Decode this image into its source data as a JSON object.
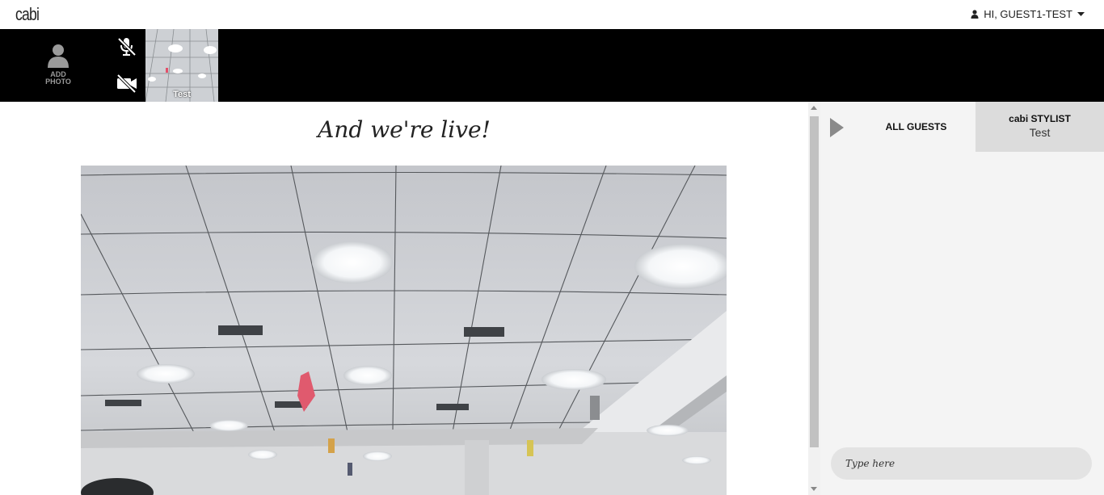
{
  "app": {
    "logo": "cabi"
  },
  "user_menu": {
    "label": "HI, GUEST1-TEST"
  },
  "strip": {
    "add_photo": {
      "line1": "ADD",
      "line2": "PHOTO"
    },
    "mic_icon": "mic-muted-icon",
    "camera_icon": "camera-off-icon",
    "participant": {
      "name": "Test"
    }
  },
  "main": {
    "title": "And we're live!"
  },
  "panel": {
    "tab_all": "ALL GUESTS",
    "tab_stylist_line1": "cabi STYLIST",
    "tab_stylist_line2": "Test",
    "chat_placeholder": "Type here"
  },
  "colors": {
    "strip_bg": "#000000",
    "panel_bg": "#f4f4f4",
    "active_tab_bg": "#dcdcdc"
  }
}
